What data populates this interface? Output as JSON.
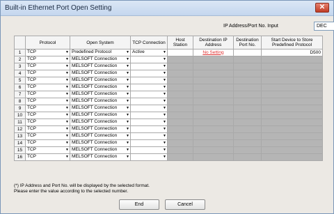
{
  "window": {
    "title": "Built-in Ethernet Port Open Setting",
    "close_label": "✕"
  },
  "format": {
    "label": "IP Address/Port No. Input",
    "value": "DEC"
  },
  "table": {
    "headers": {
      "protocol": "Protocol",
      "open_system": "Open System",
      "tcp_connection": "TCP Connection",
      "host_station": "Host Station",
      "dest_ip": "Destination IP Address",
      "dest_port": "Destination Port No.",
      "start_device": "Start Device to Store Predefined Protocol"
    },
    "rows": [
      {
        "num": "1",
        "protocol": "TCP",
        "open_system": "Predefined Protocol",
        "tcp_connection": "Active",
        "dest_ip": "No Setting",
        "start_device": "D500"
      },
      {
        "num": "2",
        "protocol": "TCP",
        "open_system": "MELSOFT Connection",
        "tcp_connection": ""
      },
      {
        "num": "3",
        "protocol": "TCP",
        "open_system": "MELSOFT Connection",
        "tcp_connection": ""
      },
      {
        "num": "4",
        "protocol": "TCP",
        "open_system": "MELSOFT Connection",
        "tcp_connection": ""
      },
      {
        "num": "5",
        "protocol": "TCP",
        "open_system": "MELSOFT Connection",
        "tcp_connection": ""
      },
      {
        "num": "6",
        "protocol": "TCP",
        "open_system": "MELSOFT Connection",
        "tcp_connection": ""
      },
      {
        "num": "7",
        "protocol": "TCP",
        "open_system": "MELSOFT Connection",
        "tcp_connection": ""
      },
      {
        "num": "8",
        "protocol": "TCP",
        "open_system": "MELSOFT Connection",
        "tcp_connection": ""
      },
      {
        "num": "9",
        "protocol": "TCP",
        "open_system": "MELSOFT Connection",
        "tcp_connection": ""
      },
      {
        "num": "10",
        "protocol": "TCP",
        "open_system": "MELSOFT Connection",
        "tcp_connection": ""
      },
      {
        "num": "11",
        "protocol": "TCP",
        "open_system": "MELSOFT Connection",
        "tcp_connection": ""
      },
      {
        "num": "12",
        "protocol": "TCP",
        "open_system": "MELSOFT Connection",
        "tcp_connection": ""
      },
      {
        "num": "13",
        "protocol": "TCP",
        "open_system": "MELSOFT Connection",
        "tcp_connection": ""
      },
      {
        "num": "14",
        "protocol": "TCP",
        "open_system": "MELSOFT Connection",
        "tcp_connection": ""
      },
      {
        "num": "15",
        "protocol": "TCP",
        "open_system": "MELSOFT Connection",
        "tcp_connection": ""
      },
      {
        "num": "16",
        "protocol": "TCP",
        "open_system": "MELSOFT Connection",
        "tcp_connection": ""
      }
    ]
  },
  "note": {
    "line1": "(*) IP Address and Port No. will be displayed by the selected format.",
    "line2": "Please enter the value according to the selected number."
  },
  "buttons": {
    "end": "End",
    "cancel": "Cancel"
  },
  "icons": {
    "dropdown": "dropdown-arrow-icon",
    "close": "close-icon"
  },
  "colors": {
    "no_setting": "#e03030",
    "disabled_cell": "#b5b5b5"
  }
}
